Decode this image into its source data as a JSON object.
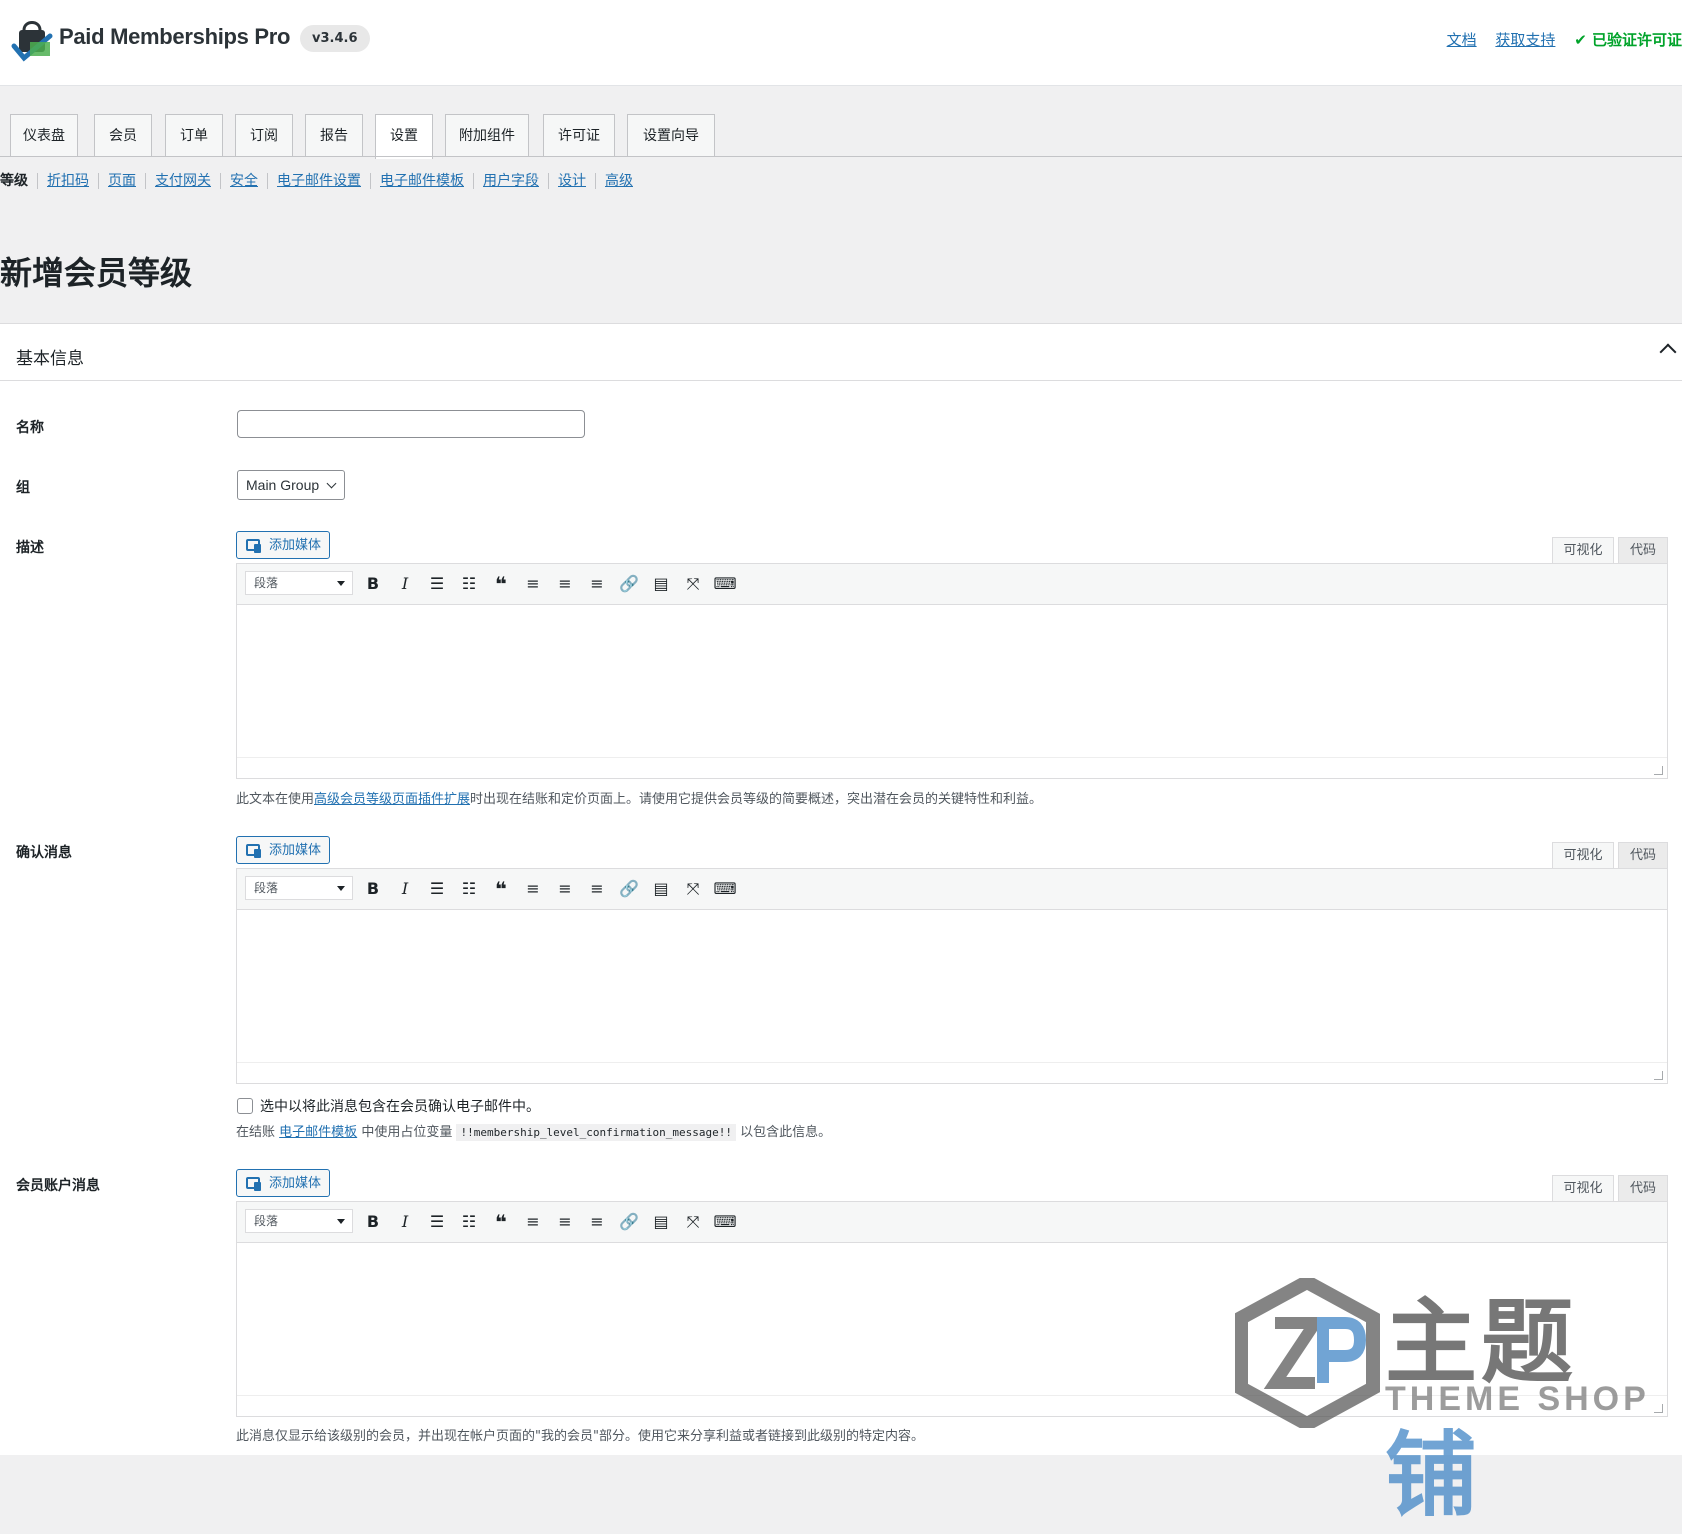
{
  "header": {
    "brand": "Paid Memberships Pro",
    "version": "v3.4.6",
    "links": [
      "文档",
      "获取支持"
    ],
    "verified": "✔ 已验证许可证"
  },
  "tabs": [
    "仪表盘",
    "会员",
    "订单",
    "订阅",
    "报告",
    "设置",
    "附加组件",
    "许可证",
    "设置向导"
  ],
  "active_tab": "设置",
  "subnav": [
    "等级",
    "折扣码",
    "页面",
    "支付网关",
    "安全",
    "电子邮件设置",
    "电子邮件模板",
    "用户字段",
    "设计",
    "高级"
  ],
  "page_title": "新增会员等级",
  "card_title": "基本信息",
  "fields": {
    "name_label": "名称",
    "name_value": "",
    "group_label": "组",
    "group_value": "Main Group",
    "desc_label": "描述",
    "confirm_label": "确认消息",
    "account_label": "会员账户消息"
  },
  "editor": {
    "add_media": "添加媒体",
    "visual": "可视化",
    "code": "代码",
    "format": "段落"
  },
  "help": {
    "desc_before": "此文本在使用",
    "desc_link": "高级会员等级页面插件扩展",
    "desc_after": "时出现在结账和定价页面上。请使用它提供会员等级的简要概述，突出潜在会员的关键特性和利益。",
    "confirm_checkbox": "选中以将此消息包含在会员确认电子邮件中。",
    "confirm_before": "在结账",
    "confirm_link": "电子邮件模板",
    "confirm_mid": "中使用占位变量",
    "confirm_code": "!!membership_level_confirmation_message!!",
    "confirm_after": "以包含此信息。",
    "account": "此消息仅显示给该级别的会员，并出现在帐户页面的\"我的会员\"部分。使用它来分享利益或者链接到此级别的特定内容。"
  },
  "watermark": {
    "cn_dark": "主题",
    "cn_blue": "铺",
    "en": "THEME SHOP"
  }
}
